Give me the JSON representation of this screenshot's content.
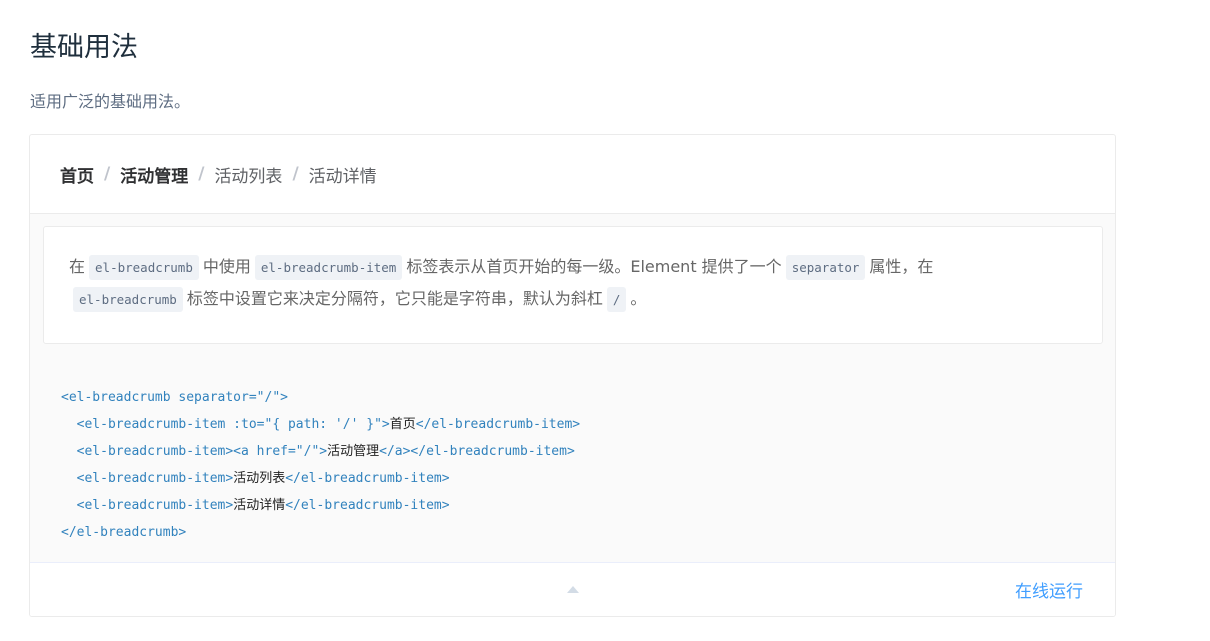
{
  "title": "基础用法",
  "subtitle": "适用广泛的基础用法。",
  "breadcrumb": {
    "items": [
      "首页",
      "活动管理",
      "活动列表",
      "活动详情"
    ],
    "separator": "/"
  },
  "description": {
    "p1": "在",
    "code1": "el-breadcrumb",
    "p2": "中使用",
    "code2": "el-breadcrumb-item",
    "p3": "标签表示从首页开始的每一级。Element 提供了一个",
    "code3": "separator",
    "p4": "属性，在",
    "code4": "el-breadcrumb",
    "p5": "标签中设置它来决定分隔符，它只能是字符串，默认为斜杠",
    "code5": "/",
    "p6": "。"
  },
  "code": {
    "l1": "<el-breadcrumb separator=\"/\">",
    "l2a": "  <el-breadcrumb-item :to=\"{ path: '/' }\">",
    "l2b": "首页",
    "l2c": "</el-breadcrumb-item>",
    "l3a": "  <el-breadcrumb-item><a href=\"/\">",
    "l3b": "活动管理",
    "l3c": "</a></el-breadcrumb-item>",
    "l4a": "  <el-breadcrumb-item>",
    "l4b": "活动列表",
    "l4c": "</el-breadcrumb-item>",
    "l5a": "  <el-breadcrumb-item>",
    "l5b": "活动详情",
    "l5c": "</el-breadcrumb-item>",
    "l6": "</el-breadcrumb>"
  },
  "control": {
    "run_label": "在线运行",
    "toggle_icon": "caret-up-icon"
  },
  "colors": {
    "accent": "#409eff",
    "code_tag": "#3182bd",
    "inline_code_bg": "#eff2f6"
  }
}
